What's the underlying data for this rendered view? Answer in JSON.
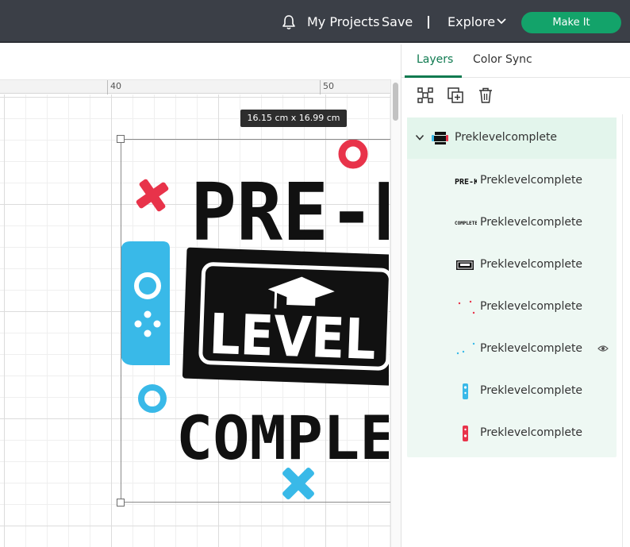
{
  "topbar": {
    "notifications_icon": "bell-icon",
    "my_projects": "My Projects",
    "save": "Save",
    "separator": "|",
    "explore": "Explore",
    "explore_icon": "chevron-down-icon",
    "make_it": "Make It",
    "accent_color": "#13a36a"
  },
  "canvas": {
    "ruler_labels": [
      "40",
      "50"
    ],
    "size_badge": "16.15  cm x 16.99  cm",
    "artwork": {
      "line1": "PRE-K",
      "line2": "LEVEL",
      "line3": "COMPLETE",
      "colors": {
        "red": "#e8334a",
        "blue": "#39b9e8",
        "black": "#111111"
      }
    }
  },
  "panel": {
    "tabs": [
      {
        "label": "Layers",
        "active": true
      },
      {
        "label": "Color Sync",
        "active": false
      }
    ],
    "tools": [
      "ungroup-icon",
      "duplicate-icon",
      "delete-icon"
    ],
    "group": {
      "name": "Preklevelcomplete",
      "expand_icon": "chevron-down-icon"
    },
    "layers": [
      {
        "name": "Preklevelcomplete",
        "thumb": "prek-text"
      },
      {
        "name": "Preklevelcomplete",
        "thumb": "complete-text"
      },
      {
        "name": "Preklevelcomplete",
        "thumb": "level-badge"
      },
      {
        "name": "Preklevelcomplete",
        "thumb": "red-dots"
      },
      {
        "name": "Preklevelcomplete",
        "thumb": "blue-dots",
        "visibility_icon": "eye-icon"
      },
      {
        "name": "Preklevelcomplete",
        "thumb": "blue-controller"
      },
      {
        "name": "Preklevelcomplete",
        "thumb": "red-controller"
      }
    ]
  }
}
